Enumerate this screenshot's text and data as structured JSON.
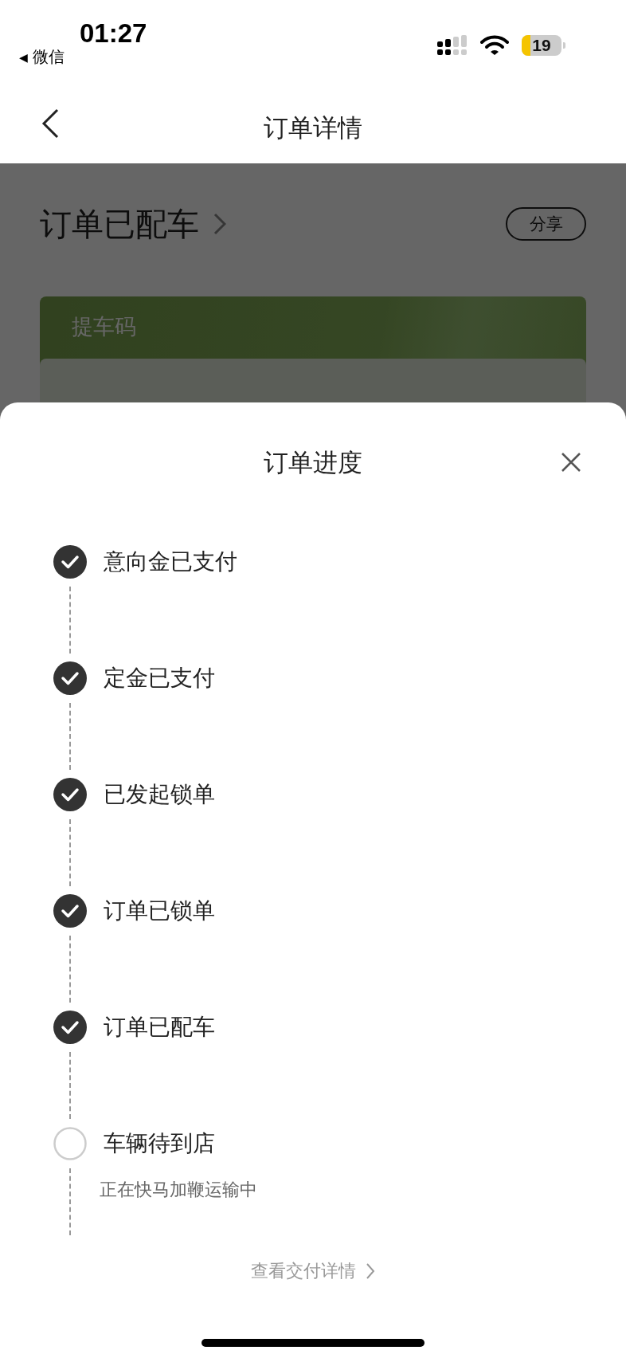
{
  "status_bar": {
    "time": "01:27",
    "back_arrow": "◀",
    "back_label": "微信",
    "battery": "19"
  },
  "nav": {
    "title": "订单详情"
  },
  "background": {
    "status": "订单已配车",
    "share_button": "分享",
    "card_label": "提车码"
  },
  "sheet": {
    "title": "订单进度",
    "steps": [
      {
        "label": "意向金已支付",
        "done": true
      },
      {
        "label": "定金已支付",
        "done": true
      },
      {
        "label": "已发起锁单",
        "done": true
      },
      {
        "label": "订单已锁单",
        "done": true
      },
      {
        "label": "订单已配车",
        "done": true
      },
      {
        "label": "车辆待到店",
        "done": false,
        "note": "正在快马加鞭运输中"
      }
    ],
    "link": "查看交付详情"
  }
}
